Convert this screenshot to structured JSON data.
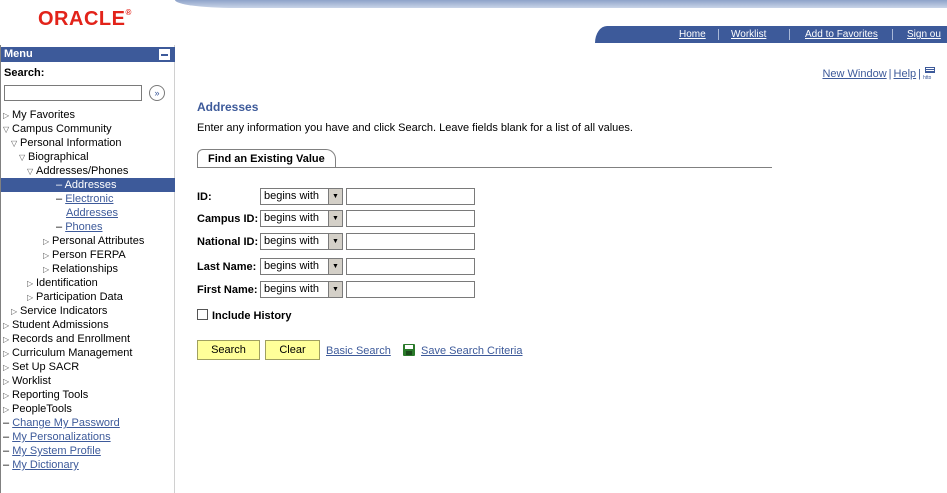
{
  "header": {
    "logo": "ORACLE",
    "nav": [
      {
        "label": "Home"
      },
      {
        "label": "Worklist"
      },
      {
        "label": "Add to Favorites"
      },
      {
        "label": "Sign ou"
      }
    ]
  },
  "sidebar": {
    "menu_title": "Menu",
    "search_label": "Search:",
    "search_value": "",
    "go_icon": "double-chevron-right-icon",
    "items": [
      {
        "label": "My Favorites",
        "state": "collapsed"
      },
      {
        "label": "Campus Community",
        "state": "expanded"
      },
      {
        "label": "Personal Information",
        "state": "expanded"
      },
      {
        "label": "Biographical",
        "state": "expanded"
      },
      {
        "label": "Addresses/Phones",
        "state": "expanded"
      },
      {
        "label": "Addresses",
        "state": "selected"
      },
      {
        "label": "Electronic",
        "state": "link"
      },
      {
        "label": "Addresses",
        "state": "link"
      },
      {
        "label": "Phones",
        "state": "link"
      },
      {
        "label": "Personal Attributes",
        "state": "collapsed"
      },
      {
        "label": "Person FERPA",
        "state": "collapsed"
      },
      {
        "label": "Relationships",
        "state": "collapsed"
      },
      {
        "label": "Identification",
        "state": "collapsed"
      },
      {
        "label": "Participation Data",
        "state": "collapsed"
      },
      {
        "label": "Service Indicators",
        "state": "collapsed"
      },
      {
        "label": "Student Admissions",
        "state": "collapsed"
      },
      {
        "label": "Records and Enrollment",
        "state": "collapsed"
      },
      {
        "label": "Curriculum Management",
        "state": "collapsed"
      },
      {
        "label": "Set Up SACR",
        "state": "collapsed"
      },
      {
        "label": "Worklist",
        "state": "collapsed"
      },
      {
        "label": "Reporting Tools",
        "state": "collapsed"
      },
      {
        "label": "PeopleTools",
        "state": "collapsed"
      },
      {
        "label": "Change My Password",
        "state": "link"
      },
      {
        "label": "My Personalizations",
        "state": "link"
      },
      {
        "label": "My System Profile",
        "state": "link"
      },
      {
        "label": "My Dictionary",
        "state": "link"
      }
    ]
  },
  "main": {
    "new_window": "New Window",
    "help": "Help",
    "title": "Addresses",
    "description": "Enter any information you have and click Search. Leave fields blank for a list of all values.",
    "tab": "Find an Existing Value",
    "fields": [
      {
        "label": "ID:",
        "operator": "begins with",
        "value": ""
      },
      {
        "label": "Campus ID:",
        "operator": "begins with",
        "value": ""
      },
      {
        "label": "National ID:",
        "operator": "begins with",
        "value": ""
      },
      {
        "label": "Last Name:",
        "operator": "begins with",
        "value": ""
      },
      {
        "label": "First Name:",
        "operator": "begins with",
        "value": ""
      }
    ],
    "include_history": "Include History",
    "include_history_checked": false,
    "search_button": "Search",
    "clear_button": "Clear",
    "basic_search": "Basic Search",
    "save_search": "Save Search Criteria"
  },
  "colors": {
    "brand_red": "#e2231a",
    "nav_blue": "#3d5a9a",
    "button_yellow": "#ffff99"
  }
}
